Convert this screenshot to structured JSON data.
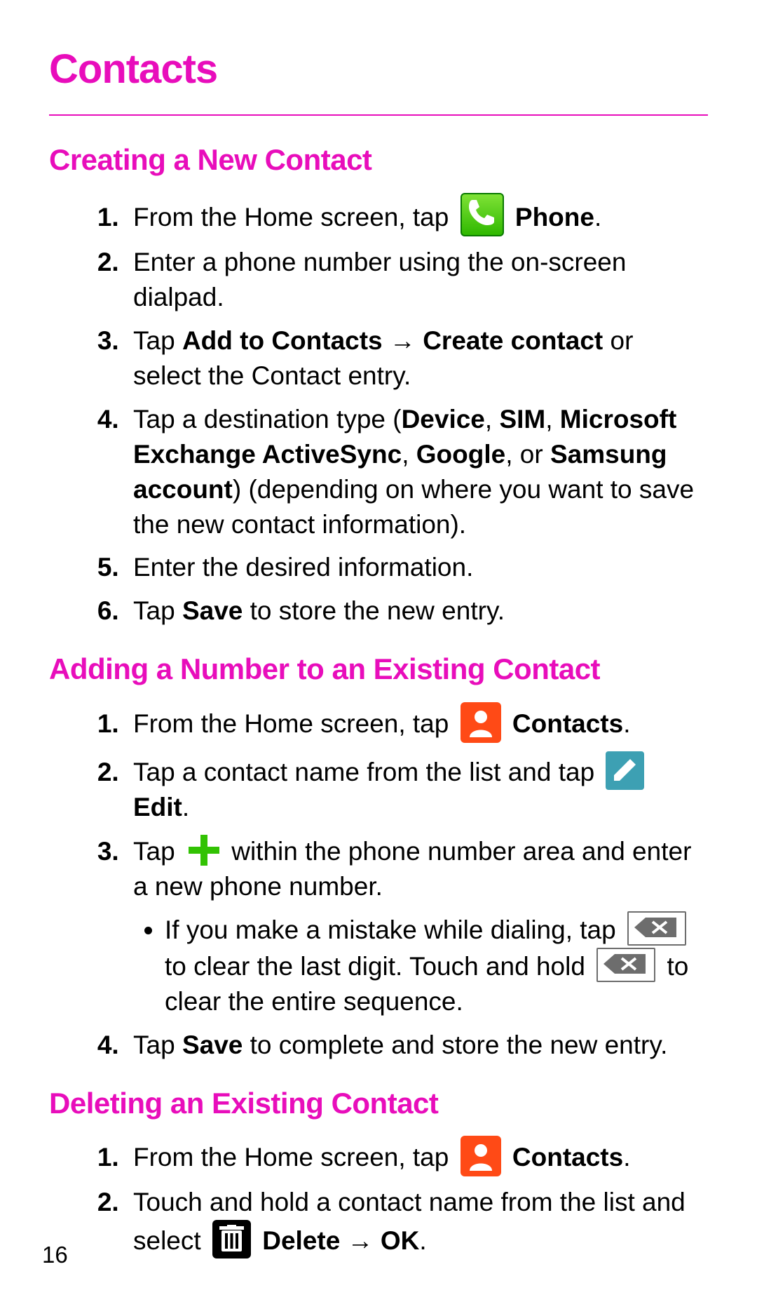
{
  "page_number": "16",
  "title": "Contacts",
  "sections": {
    "creating": {
      "heading": "Creating a New Contact",
      "steps": {
        "s1_pre": "From the Home screen, tap ",
        "s1_iconLabel": " Phone",
        "s1_post": ".",
        "s2": "Enter a phone number using the on-screen dialpad.",
        "s3_pre": "Tap ",
        "s3_b1": "Add to Contacts → Create contact",
        "s3_post": " or select the Contact entry.",
        "s4_pre": "Tap a destination type (",
        "s4_b1": "Device",
        "s4_sep1": ", ",
        "s4_b2": "SIM",
        "s4_sep2": ", ",
        "s4_b3": "Microsoft Exchange ActiveSync",
        "s4_sep3": ", ",
        "s4_b4": "Google",
        "s4_sep4": ", or ",
        "s4_b5": "Samsung account",
        "s4_post": ") (depending on where you want to save the new contact information).",
        "s5": "Enter the desired information.",
        "s6_pre": "Tap ",
        "s6_b1": "Save",
        "s6_post": " to store the new entry."
      }
    },
    "adding": {
      "heading": "Adding a Number to an Existing Contact",
      "steps": {
        "s1_pre": "From the Home screen, tap ",
        "s1_iconLabel": " Contacts",
        "s1_post": ".",
        "s2_pre": "Tap a contact name from the list and tap ",
        "s2_iconLabel": " Edit",
        "s2_post": ".",
        "s3_pre": "Tap ",
        "s3_mid": " within the phone number area and enter a new phone number.",
        "sub1_pre": "If you make a mistake while dialing, tap ",
        "sub1_mid": " to clear the last digit. Touch and hold ",
        "sub1_post": " to clear the entire sequence.",
        "s4_pre": "Tap ",
        "s4_b1": "Save",
        "s4_post": " to complete and store the new entry."
      }
    },
    "deleting": {
      "heading": "Deleting an Existing Contact",
      "steps": {
        "s1_pre": "From the Home screen, tap ",
        "s1_iconLabel": " Contacts",
        "s1_post": ".",
        "s2_pre": "Touch and hold a contact name from the list and select ",
        "s2_b1": " Delete → OK",
        "s2_post": "."
      }
    }
  }
}
